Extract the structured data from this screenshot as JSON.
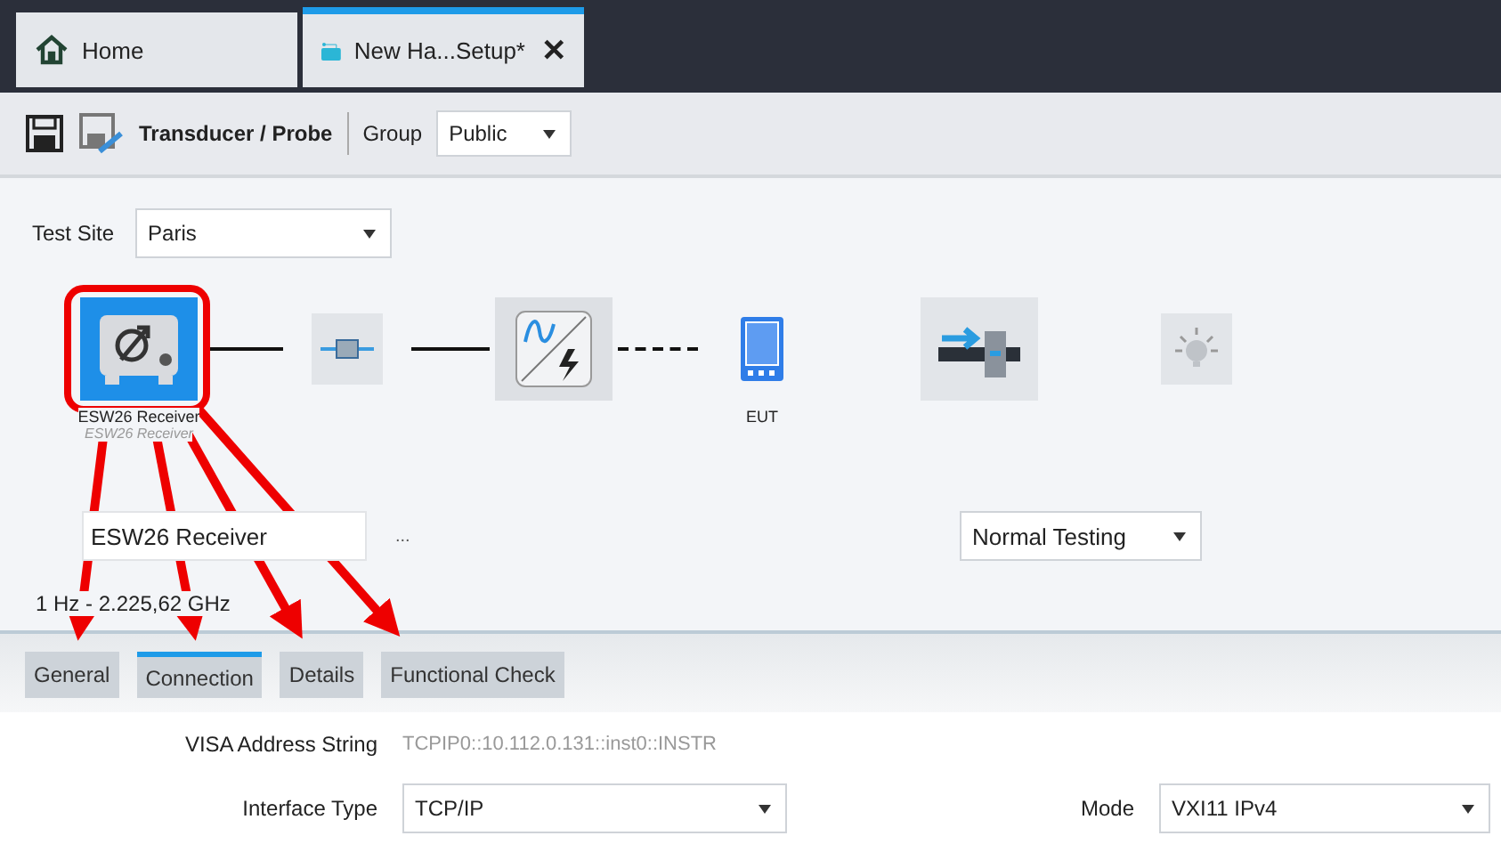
{
  "doc_tabs": [
    {
      "label": "Home",
      "kind": "home",
      "selected": false
    },
    {
      "label": "New Ha...Setup*",
      "kind": "setup",
      "selected": true,
      "close": "✕"
    }
  ],
  "toolbar": {
    "title": "Transducer / Probe",
    "group_label": "Group",
    "group_value": "Public"
  },
  "test_site": {
    "label": "Test Site",
    "value": "Paris"
  },
  "diagram": [
    {
      "kind": "receiver",
      "selected": true,
      "label": "ESW26 Receiver",
      "sublabel": "ESW26 Receiver",
      "linked": true,
      "dashed": false
    },
    {
      "kind": "coupler",
      "selected": false,
      "linked": true,
      "dashed": false
    },
    {
      "kind": "converter",
      "selected": false,
      "linked": true,
      "dashed": true
    },
    {
      "kind": "eut",
      "selected": false,
      "label": "EUT",
      "linked": false
    },
    {
      "kind": "switch",
      "selected": false,
      "linked": false
    },
    {
      "kind": "lamp",
      "selected": false
    }
  ],
  "device_name": "ESW26 Receiver",
  "browse": "...",
  "mode_select": "Normal Testing",
  "frequency_range": "1 Hz - 2.225,62 GHz",
  "detail_tabs": [
    {
      "label": "General",
      "selected": false
    },
    {
      "label": "Connection",
      "selected": true
    },
    {
      "label": "Details",
      "selected": false
    },
    {
      "label": "Functional Check",
      "selected": false
    }
  ],
  "visa": {
    "label": "VISA Address String",
    "value": "TCPIP0::10.112.0.131::inst0::INSTR"
  },
  "interface_type": {
    "label": "Interface Type",
    "value": "TCP/IP"
  },
  "mode": {
    "label": "Mode",
    "value": "VXI11 IPv4"
  }
}
